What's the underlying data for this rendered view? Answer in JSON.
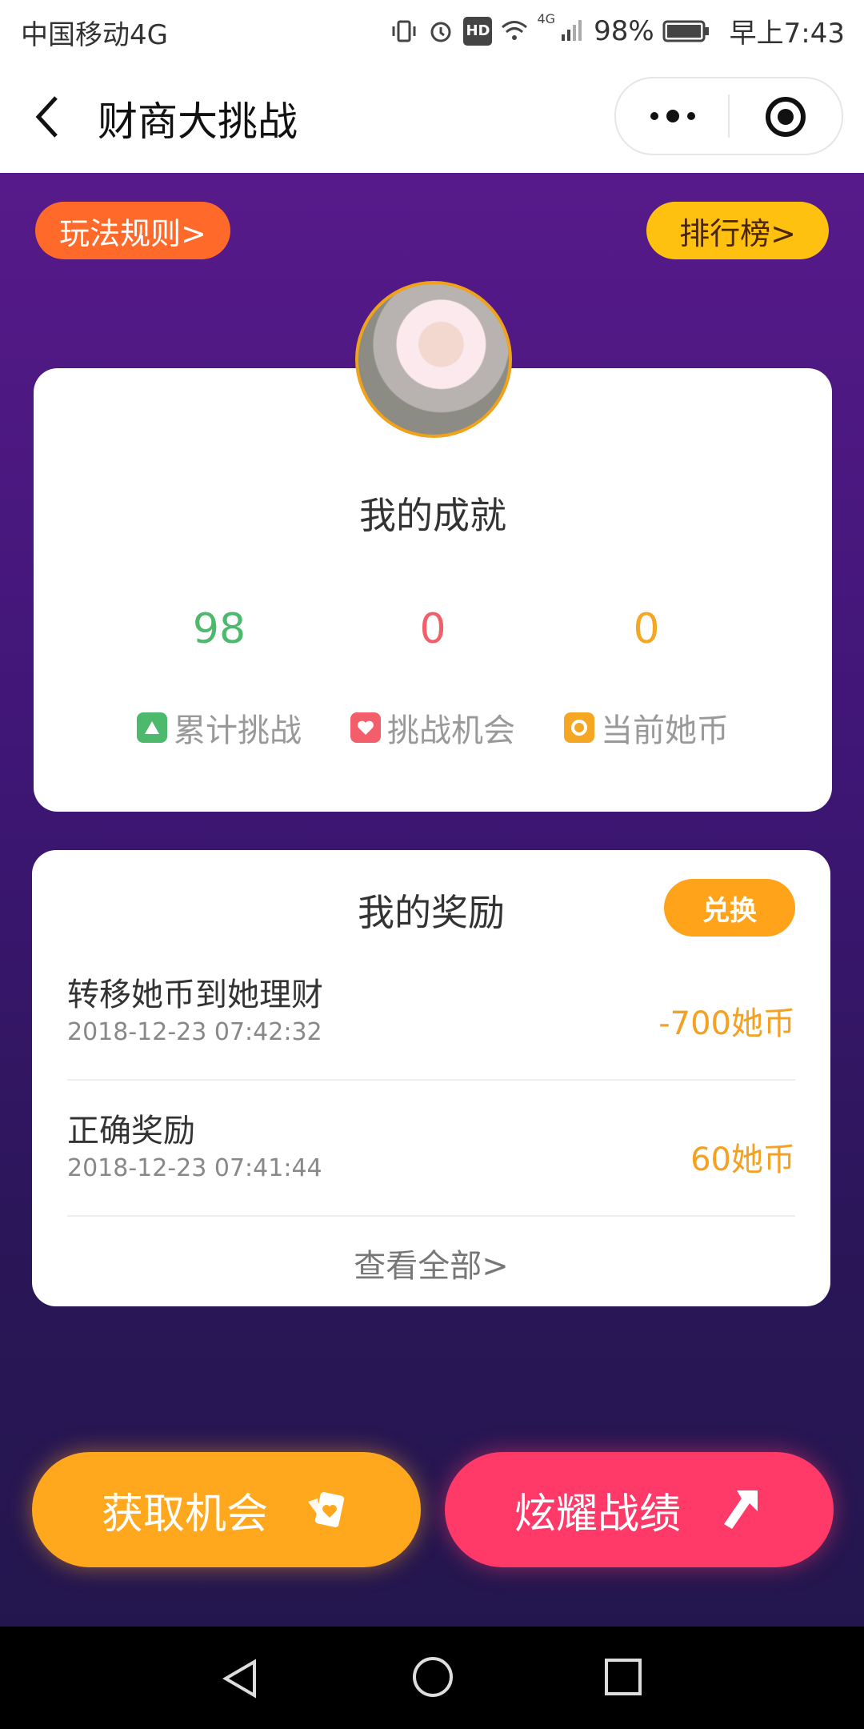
{
  "status_bar": {
    "carrier": "中国移动4G",
    "battery": "98%",
    "time": "早上7:43",
    "signal_label": "4G",
    "hd_label": "HD"
  },
  "header": {
    "title": "财商大挑战"
  },
  "buttons": {
    "rules": "玩法规则>",
    "ranking": "排行榜>"
  },
  "achievements": {
    "title": "我的成就",
    "stats": [
      {
        "value": "98",
        "label": "累计挑战",
        "color": "#4cb96c"
      },
      {
        "value": "0",
        "label": "挑战机会",
        "color": "#f25f6a"
      },
      {
        "value": "0",
        "label": "当前她币",
        "color": "#f5a623"
      }
    ]
  },
  "rewards": {
    "title": "我的奖励",
    "exchange_label": "兑换",
    "items": [
      {
        "name": "转移她币到她理财",
        "time": "2018-12-23 07:42:32",
        "amount": "-700她币"
      },
      {
        "name": "正确奖励",
        "time": "2018-12-23 07:41:44",
        "amount": "60她币"
      }
    ],
    "view_all": "查看全部>"
  },
  "actions": {
    "get_chance": "获取机会",
    "show_off": "炫耀战绩"
  },
  "colors": {
    "accent_orange": "#ffa81e",
    "accent_pink": "#ff3a68",
    "bg_purple": "#571a8a"
  }
}
